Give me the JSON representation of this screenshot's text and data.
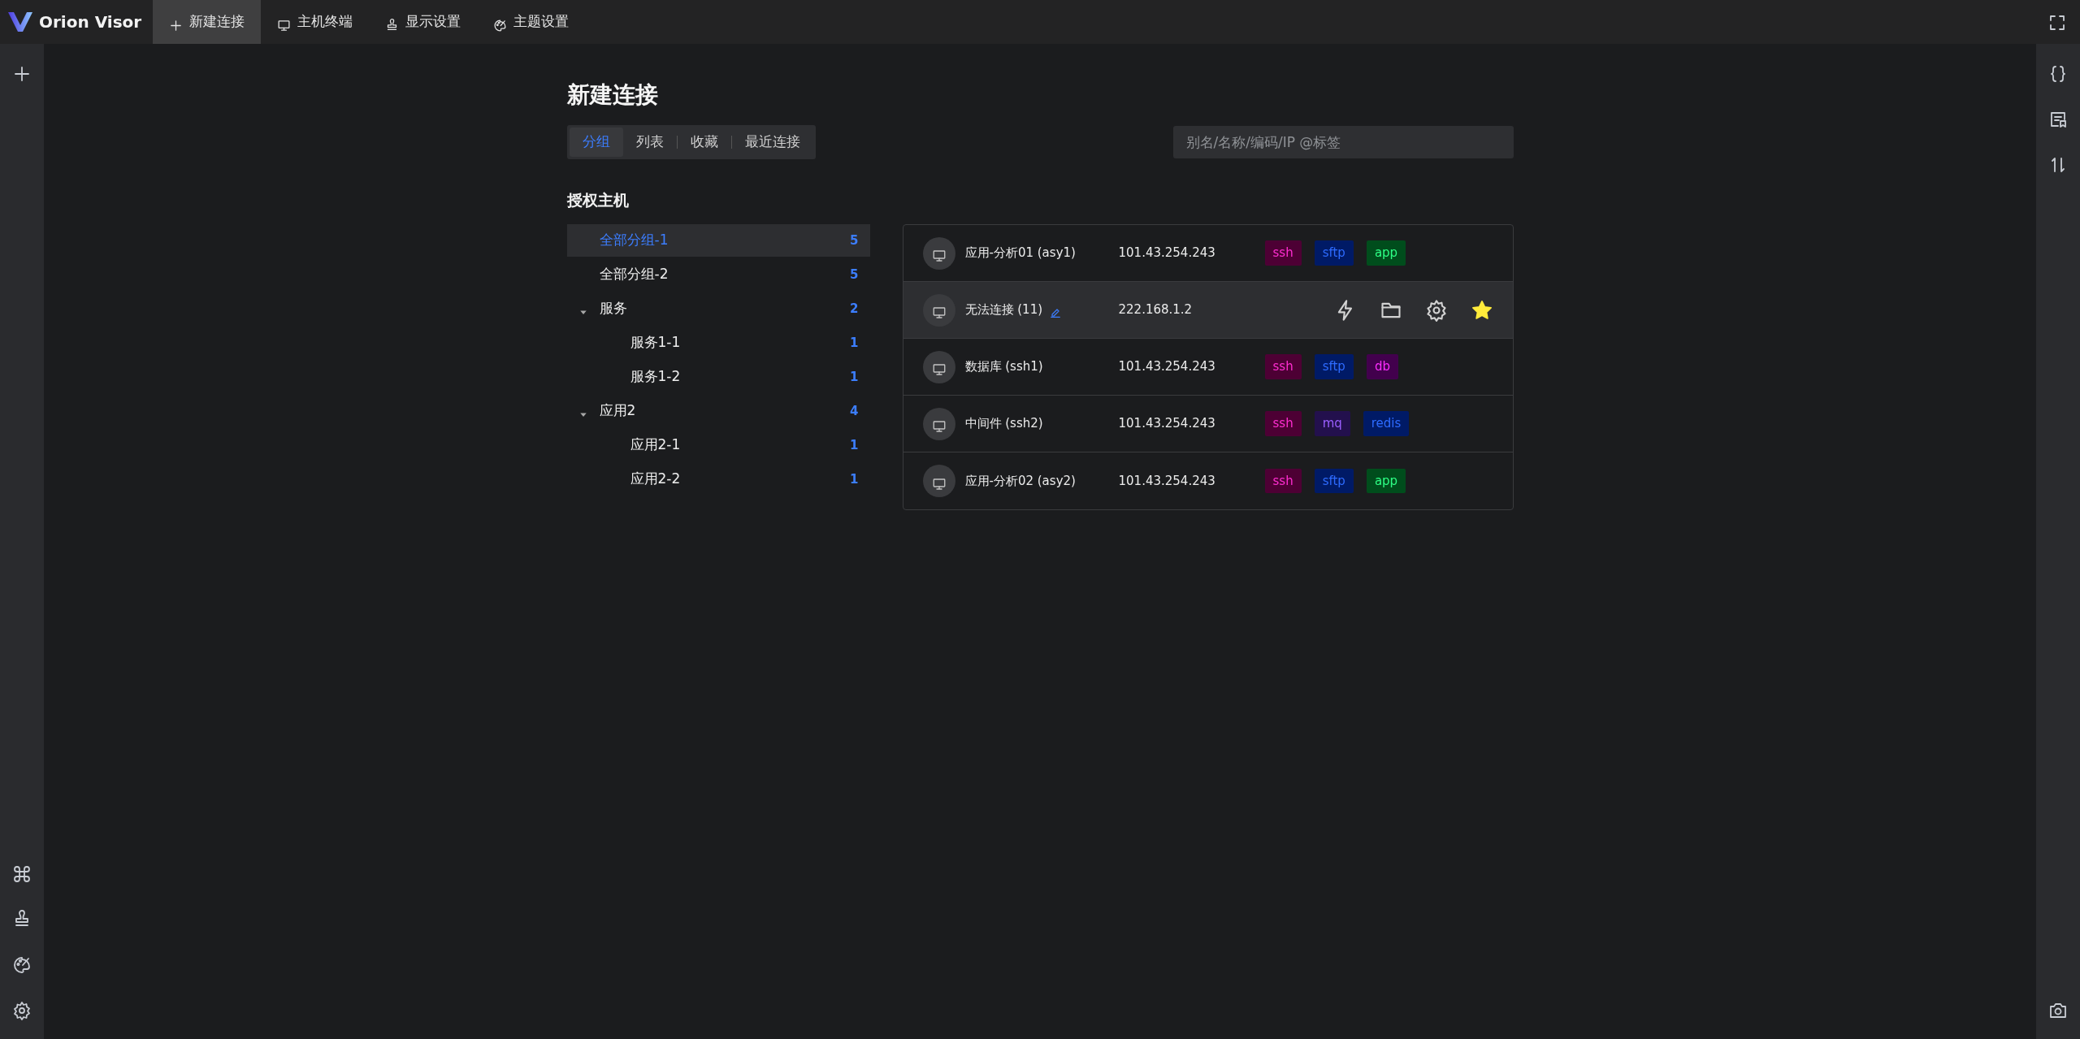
{
  "app": {
    "name": "Orion Visor"
  },
  "top_tabs": [
    {
      "label": "新建连接",
      "selected": true
    },
    {
      "label": "主机终端",
      "selected": false
    },
    {
      "label": "显示设置",
      "selected": false
    },
    {
      "label": "主题设置",
      "selected": false
    }
  ],
  "page_title": "新建连接",
  "view_tabs": [
    {
      "label": "分组",
      "selected": true
    },
    {
      "label": "列表",
      "selected": false
    },
    {
      "label": "收藏",
      "selected": false
    },
    {
      "label": "最近连接",
      "selected": false
    }
  ],
  "search": {
    "placeholder": "别名/名称/编码/IP @标签"
  },
  "section_title": "授权主机",
  "groups": [
    {
      "label": "全部分组-1",
      "count": "5",
      "selected": true
    },
    {
      "label": "全部分组-2",
      "count": "5",
      "selected": false
    },
    {
      "label": "服务",
      "count": "2",
      "selected": false,
      "expanded": true,
      "children": [
        {
          "label": "服务1-1",
          "count": "1",
          "selected": false
        },
        {
          "label": "服务1-2",
          "count": "1",
          "selected": false
        }
      ]
    },
    {
      "label": "应用2",
      "count": "4",
      "selected": false,
      "expanded": true,
      "children": [
        {
          "label": "应用2-1",
          "count": "1",
          "selected": false
        },
        {
          "label": "应用2-2",
          "count": "1",
          "selected": false
        }
      ]
    }
  ],
  "hosts": [
    {
      "name": "应用-分析01 (asy1)",
      "address": "101.43.254.243",
      "hovered": false,
      "tags": [
        {
          "label": "ssh",
          "color": "#4d0034"
        },
        {
          "label": "sftp",
          "color": "#001a66"
        },
        {
          "label": "app",
          "color": "#004d1c"
        }
      ]
    },
    {
      "name": "无法连接 (11)",
      "address": "222.168.1.2",
      "hovered": true,
      "favorite": true
    },
    {
      "name": "数据库 (ssh1)",
      "address": "101.43.254.243",
      "hovered": false,
      "tags": [
        {
          "label": "ssh",
          "color": "#4d0034"
        },
        {
          "label": "sftp",
          "color": "#001a66"
        },
        {
          "label": "db",
          "color": "#42004d"
        }
      ]
    },
    {
      "name": "中间件 (ssh2)",
      "address": "101.43.254.243",
      "hovered": false,
      "tags": [
        {
          "label": "ssh",
          "color": "#4d0034"
        },
        {
          "label": "mq",
          "color": "#23104d"
        },
        {
          "label": "redis",
          "color": "#001a66"
        }
      ]
    },
    {
      "name": "应用-分析02 (asy2)",
      "address": "101.43.254.243",
      "hovered": false,
      "tags": [
        {
          "label": "ssh",
          "color": "#4d0034"
        },
        {
          "label": "sftp",
          "color": "#001a66"
        },
        {
          "label": "app",
          "color": "#004d1c"
        }
      ]
    }
  ]
}
